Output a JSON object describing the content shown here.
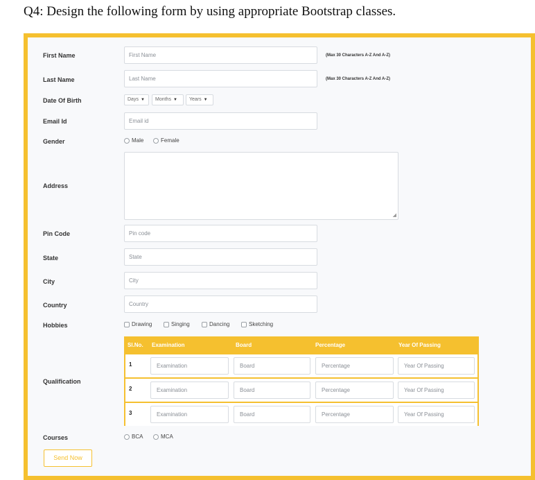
{
  "question": "Q4: Design the following form by using appropriate Bootstrap classes.",
  "form": {
    "first_name": {
      "label": "First Name",
      "placeholder": "First Name",
      "note": "(Max 30 Characters A-Z And A-Z)"
    },
    "last_name": {
      "label": "Last Name",
      "placeholder": "Last Name",
      "note": "(Max 30 Characters A-Z And A-Z)"
    },
    "dob": {
      "label": "Date Of Birth",
      "days": "Days",
      "months": "Months",
      "years": "Years"
    },
    "email": {
      "label": "Email Id",
      "placeholder": "Email id"
    },
    "gender": {
      "label": "Gender",
      "options": [
        "Male",
        "Female"
      ]
    },
    "address": {
      "label": "Address"
    },
    "pin": {
      "label": "Pin Code",
      "placeholder": "Pin code"
    },
    "state": {
      "label": "State",
      "placeholder": "State"
    },
    "city": {
      "label": "City",
      "placeholder": "City"
    },
    "country": {
      "label": "Country",
      "placeholder": "Country"
    },
    "hobbies": {
      "label": "Hobbies",
      "options": [
        "Drawing",
        "Singing",
        "Dancing",
        "Sketching"
      ]
    },
    "qualification": {
      "label": "Qualification",
      "headers": [
        "Sl.No.",
        "Examination",
        "Board",
        "Percentage",
        "Year Of Passing"
      ],
      "rows": [
        {
          "num": "1",
          "exam": "Examination",
          "board": "Board",
          "percentage": "Percentage",
          "year": "Year Of Passing"
        },
        {
          "num": "2",
          "exam": "Examination",
          "board": "Board",
          "percentage": "Percentage",
          "year": "Year Of Passing"
        },
        {
          "num": "3",
          "exam": "Examination",
          "board": "Board",
          "percentage": "Percentage",
          "year": "Year Of Passing"
        }
      ]
    },
    "courses": {
      "label": "Courses",
      "options": [
        "BCA",
        "MCA"
      ]
    },
    "submit": "Send Now"
  },
  "colors": {
    "accent": "#f5c02f",
    "panel": "#f8f9fb",
    "input_border": "#d7dbe0"
  }
}
